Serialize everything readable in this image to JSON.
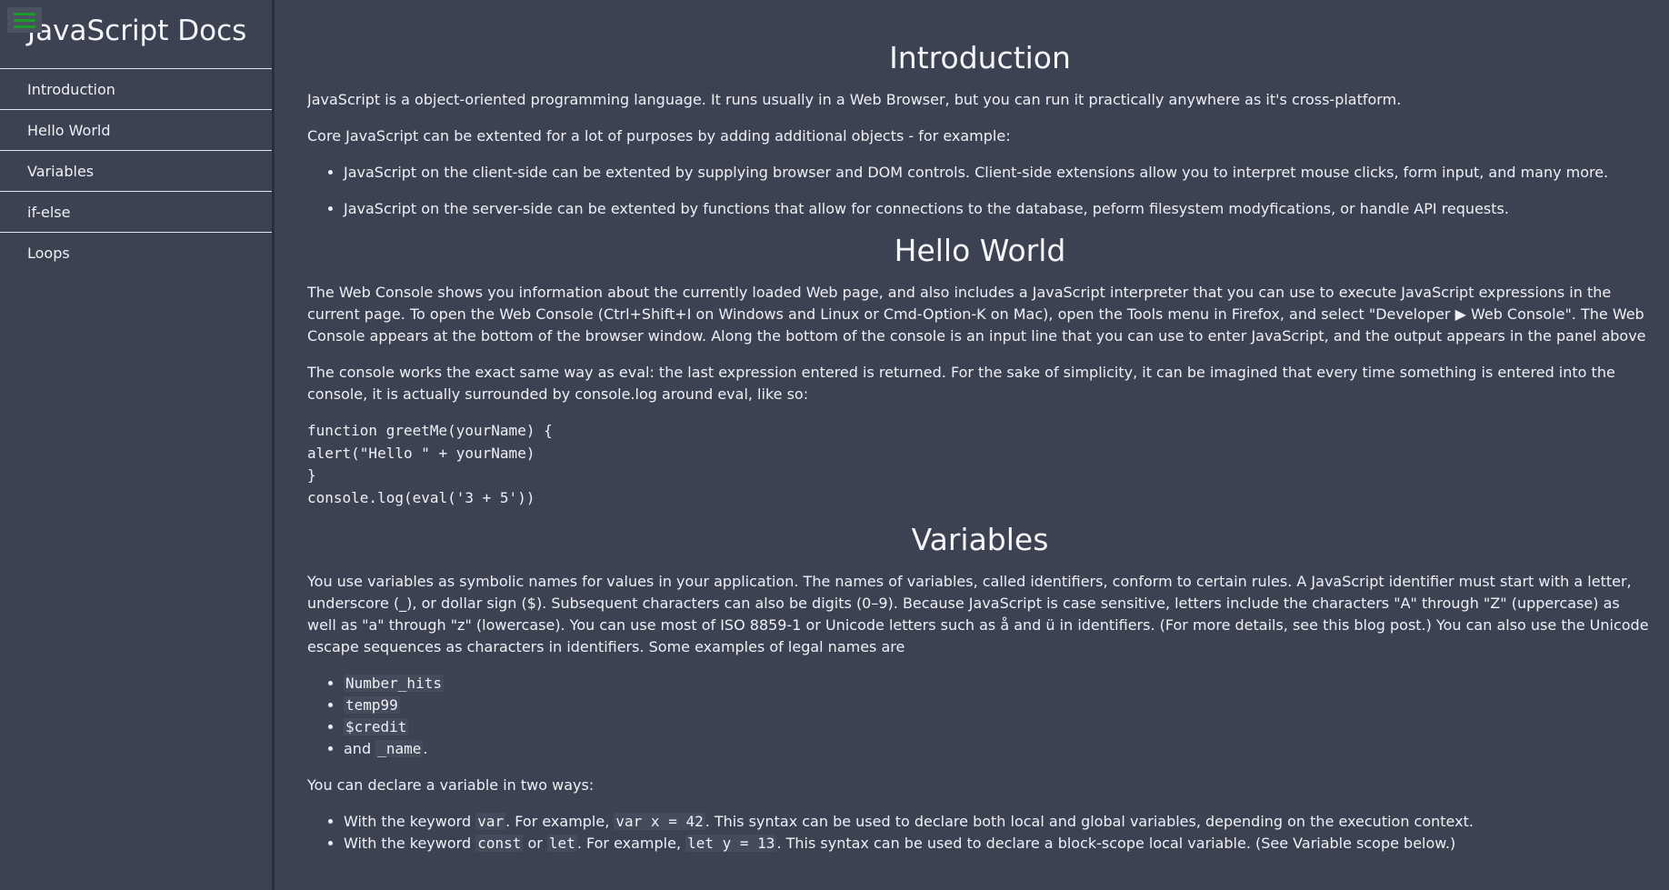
{
  "nav": {
    "header": "JavaScript Docs",
    "menu_icon": "hamburger-icon",
    "items": [
      {
        "label": "Introduction"
      },
      {
        "label": "Hello World"
      },
      {
        "label": "Variables"
      },
      {
        "label": "if-else"
      },
      {
        "label": "Loops"
      }
    ]
  },
  "intro": {
    "title": "Introduction",
    "p1": "JavaScript is a object-oriented programming language. It runs usually in a Web Browser, but you can run it practically anywhere as it's cross-platform.",
    "p2": "Core JavaScript can be extented for a lot of purposes by adding additional objects - for example:",
    "bullets": [
      "JavaScript on the client-side can be extented by supplying browser and DOM controls. Client-side extensions allow you to interpret mouse clicks, form input, and many more.",
      "JavaScript on the server-side can be extented by functions that allow for connections to the database, peform filesystem modyfications, or handle API requests."
    ]
  },
  "hello": {
    "title": "Hello World",
    "p1": "The Web Console shows you information about the currently loaded Web page, and also includes a JavaScript interpreter that you can use to execute JavaScript expressions in the current page. To open the Web Console (Ctrl+Shift+I on Windows and Linux or Cmd-Option-K on Mac), open the Tools menu in Firefox, and select \"Developer ▶ Web Console\". The Web Console appears at the bottom of the browser window. Along the bottom of the console is an input line that you can use to enter JavaScript, and the output appears in the panel above",
    "p2": "The console works the exact same way as eval: the last expression entered is returned. For the sake of simplicity, it can be imagined that every time something is entered into the console, it is actually surrounded by console.log around eval, like so:",
    "code": "function greetMe(yourName) {\nalert(\"Hello \" + yourName)\n}\nconsole.log(eval('3 + 5'))"
  },
  "vars": {
    "title": "Variables",
    "p1": "You use variables as symbolic names for values in your application. The names of variables, called identifiers, conform to certain rules. A JavaScript identifier must start with a letter, underscore (_), or dollar sign ($). Subsequent characters can also be digits (0–9). Because JavaScript is case sensitive, letters include the characters \"A\" through \"Z\" (uppercase) as well as \"a\" through \"z\" (lowercase). You can use most of ISO 8859-1 or Unicode letters such as å and ü in identifiers. (For more details, see this blog post.) You can also use the Unicode escape sequences as characters in identifiers. Some examples of legal names are",
    "names": [
      "Number_hits",
      "temp99",
      "$credit"
    ],
    "last_name_prefix": "and ",
    "last_name_code": "_name",
    "last_name_suffix": ".",
    "p2": "You can declare a variable in two ways:",
    "decl1": {
      "a": "With the keyword ",
      "code1": "var",
      "b": ". For example, ",
      "code2": "var x = 42",
      "c": ". This syntax can be used to declare both local and global variables, depending on the execution context."
    },
    "decl2": {
      "a": "With the keyword ",
      "code1": "const",
      "b": " or ",
      "code2": "let",
      "c": ". For example, ",
      "code3": "let y = 13",
      "d": ". This syntax can be used to declare a block-scope local variable. (See Variable scope below.)"
    }
  }
}
